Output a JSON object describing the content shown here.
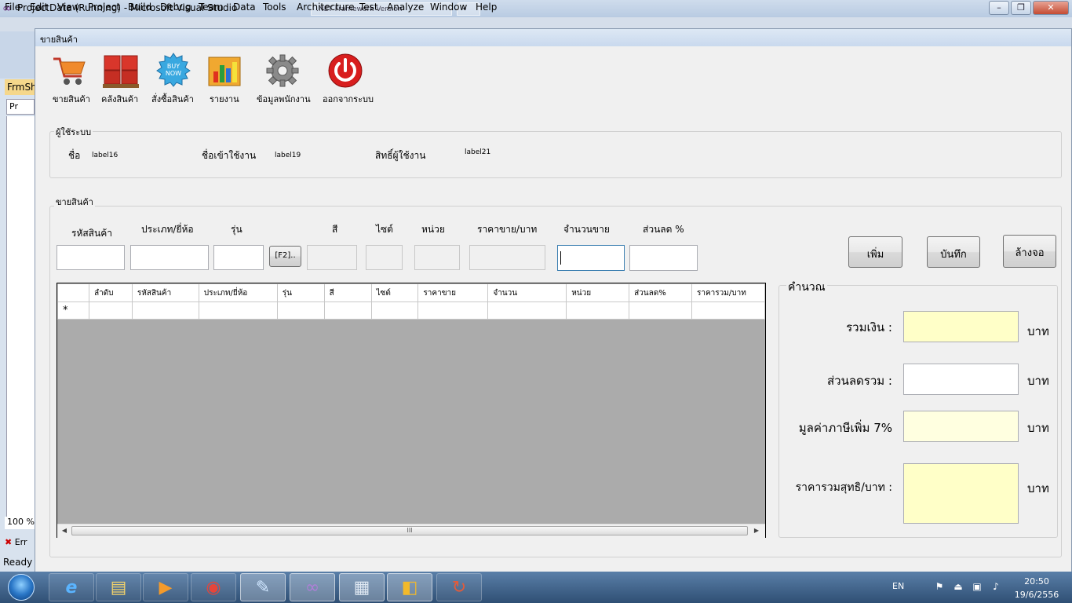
{
  "vs": {
    "title": "ProjectData (Running) - Microsoft Visual Studio",
    "tabs": [
      ".NET Framework Version",
      "•"
    ],
    "menu": [
      "File",
      "Edit",
      "View",
      "Project",
      "Build",
      "Debug",
      "Team",
      "Data",
      "Tools",
      "Architecture",
      "Test",
      "Analyze",
      "Window",
      "Help"
    ],
    "doc_tab": "FrmSh",
    "solution_item": "Pr",
    "zoom": "100 %",
    "error_list": "Err",
    "status": "Ready"
  },
  "form": {
    "title": "ขายสินค้า",
    "toolbar": [
      {
        "label": "ขายสินค้า",
        "icon": "shopping-cart-icon"
      },
      {
        "label": "คลังสินค้า",
        "icon": "warehouse-boxes-icon"
      },
      {
        "label": "สั่งซื้อสินค้า",
        "icon": "buy-now-badge-icon"
      },
      {
        "label": "รายงาน",
        "icon": "report-chart-icon"
      },
      {
        "label": "ข้อมูลพนักงาน",
        "icon": "gear-icon"
      },
      {
        "label": "ออกจากระบบ",
        "icon": "power-icon"
      }
    ],
    "user_group": {
      "title": "ผู้ใช้ระบบ",
      "name_label": "ชื่อ",
      "name_value": "label16",
      "username_label": "ชื่อเข้าใช้งาน",
      "username_value": "label19",
      "rights_label": "สิทธิ์ผู้ใช้งาน",
      "rights_value": "label21"
    },
    "sale_group": {
      "title": "ขายสินค้า",
      "labels": {
        "code": "รหัสสินค้า",
        "type": "ประเภท/ยี่ห้อ",
        "model": "รุ่น",
        "color": "สี",
        "size": "ไซต์",
        "unit": "หน่วย",
        "price": "ราคาขาย/บาท",
        "qty": "จำนวนขาย",
        "discount": "ส่วนลด %"
      },
      "f2_button": "[F2]..",
      "buttons": {
        "add": "เพิ่ม",
        "save": "บันทึก",
        "clear": "ล้างจอ"
      }
    },
    "grid": {
      "columns": [
        "ลำดับ",
        "รหัสสินค้า",
        "ประเภท/ยี่ห้อ",
        "รุ่น",
        "สี",
        "ไซต์",
        "ราคาขาย",
        "จำนวน",
        "หน่วย",
        "ส่วนลด%",
        "ราคารวม/บาท"
      ],
      "new_row_marker": "*",
      "scroll_thumb": "III"
    },
    "calc_group": {
      "title": "คำนวณ",
      "total_label": "รวมเงิน :",
      "discount_label": "ส่วนลดรวม :",
      "vat_label": "มูลค่าภาษีเพิ่ม 7%",
      "net_label": "ราคารวมสุทธิ/บาท :",
      "unit": "บาท"
    }
  },
  "taskbar": {
    "language": "EN",
    "time": "20:50",
    "date": "19/6/2556",
    "apps": [
      {
        "name": "internet-explorer-icon",
        "glyph": "e"
      },
      {
        "name": "file-explorer-icon",
        "glyph": "▤"
      },
      {
        "name": "media-player-icon",
        "glyph": "▶"
      },
      {
        "name": "chrome-icon",
        "glyph": "◉"
      },
      {
        "name": "notepad-icon",
        "glyph": "✎"
      },
      {
        "name": "visual-studio-icon",
        "glyph": "∞"
      },
      {
        "name": "calculator-icon",
        "glyph": "▦"
      },
      {
        "name": "paint-icon",
        "glyph": "◧"
      },
      {
        "name": "running-app-icon",
        "glyph": "↻"
      }
    ]
  }
}
